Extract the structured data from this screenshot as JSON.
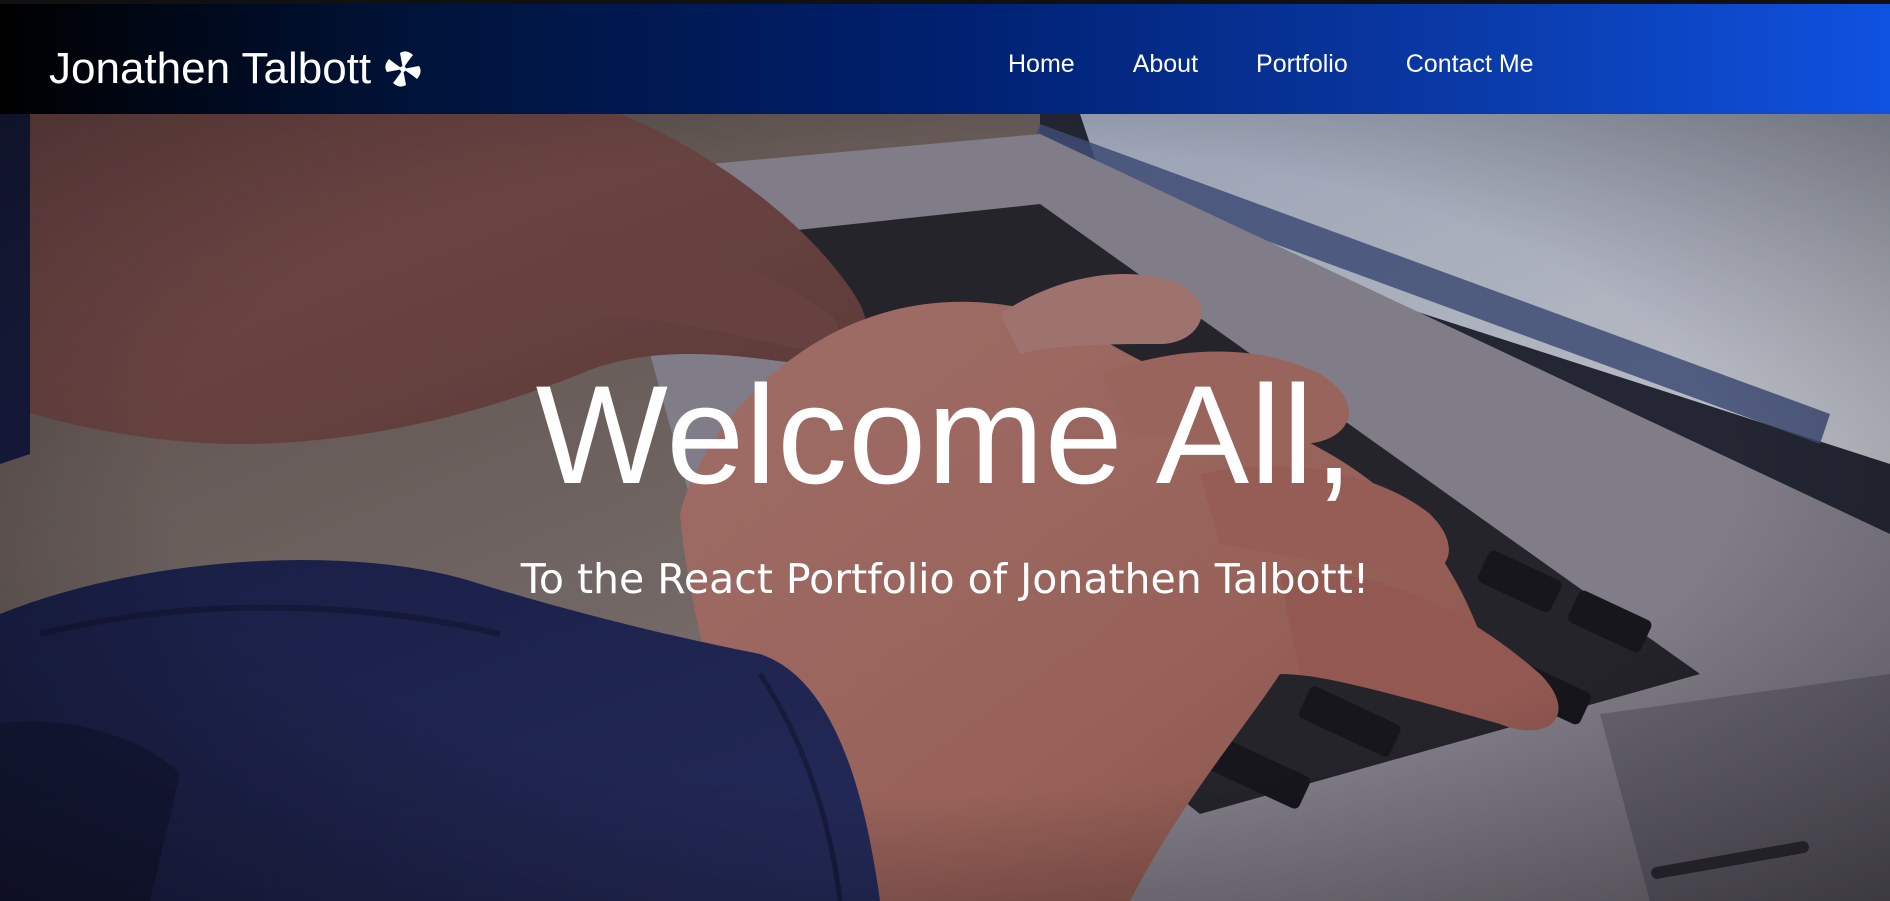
{
  "navbar": {
    "brand": "Jonathen Talbott",
    "brand_icon": "pinwheel-icon",
    "links": [
      {
        "label": "Home"
      },
      {
        "label": "About"
      },
      {
        "label": "Portfolio"
      },
      {
        "label": "Contact Me"
      }
    ],
    "gradient_colors": [
      "#000000",
      "#002070",
      "#0f52e0"
    ]
  },
  "hero": {
    "title": "Welcome All,",
    "subtitle": "To the React Portfolio of Jonathen Talbott!",
    "background": "typing-on-laptop-photo"
  }
}
